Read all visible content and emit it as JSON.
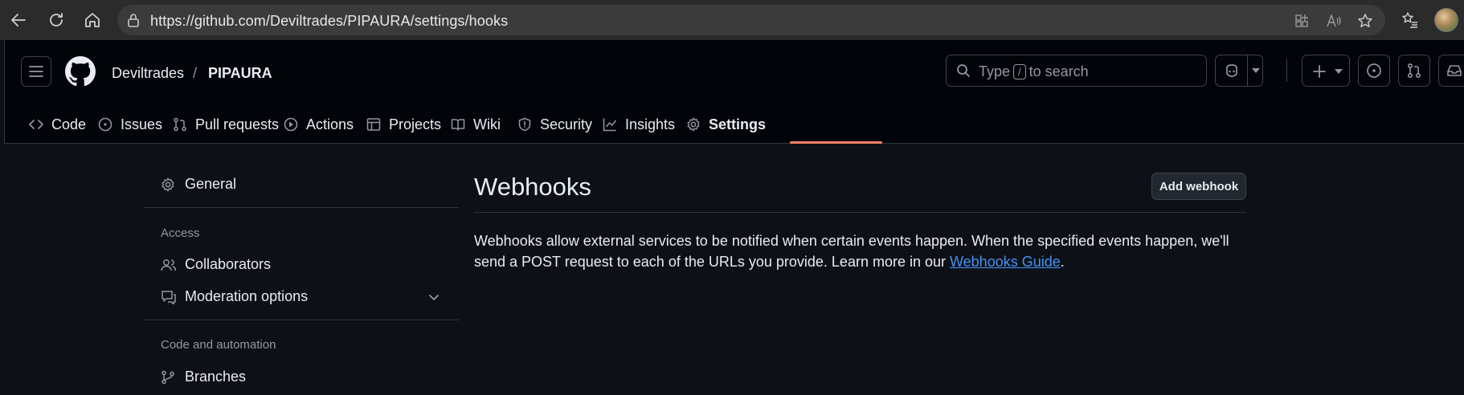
{
  "browser": {
    "url": "https://github.com/Deviltrades/PIPAURA/settings/hooks",
    "icons": [
      "back-icon",
      "refresh-icon",
      "home-icon",
      "lock-icon",
      "apps-icon",
      "read-aloud-icon",
      "favorite-icon",
      "favorites-list-icon",
      "profile-avatar"
    ]
  },
  "header": {
    "owner": "Deviltrades",
    "separator": "/",
    "repo": "PIPAURA",
    "search": {
      "prefix": "Type",
      "key": "/",
      "suffix": "to search"
    }
  },
  "tabs": [
    {
      "label": "Code",
      "icon": "code-icon",
      "active": false
    },
    {
      "label": "Issues",
      "icon": "issue-icon",
      "active": false
    },
    {
      "label": "Pull requests",
      "icon": "pull-request-icon",
      "active": false
    },
    {
      "label": "Actions",
      "icon": "play-icon",
      "active": false
    },
    {
      "label": "Projects",
      "icon": "table-icon",
      "active": false
    },
    {
      "label": "Wiki",
      "icon": "book-icon",
      "active": false
    },
    {
      "label": "Security",
      "icon": "shield-icon",
      "active": false
    },
    {
      "label": "Insights",
      "icon": "graph-icon",
      "active": false
    },
    {
      "label": "Settings",
      "icon": "gear-icon",
      "active": true
    }
  ],
  "sidebar": {
    "general": "General",
    "access_heading": "Access",
    "collaborators": "Collaborators",
    "moderation": "Moderation options",
    "code_heading": "Code and automation",
    "branches": "Branches"
  },
  "main": {
    "title": "Webhooks",
    "add_button": "Add webhook",
    "description": "Webhooks allow external services to be notified when certain events happen. When the specified events happen, we'll send a POST request to each of the URLs you provide. Learn more in our ",
    "link_text": "Webhooks Guide",
    "description_end": "."
  },
  "colors": {
    "background": "#0d1117",
    "header_background": "#010409",
    "active_tab_underline": "#f78166",
    "link": "#4493f8",
    "muted_text": "#9198a1"
  }
}
